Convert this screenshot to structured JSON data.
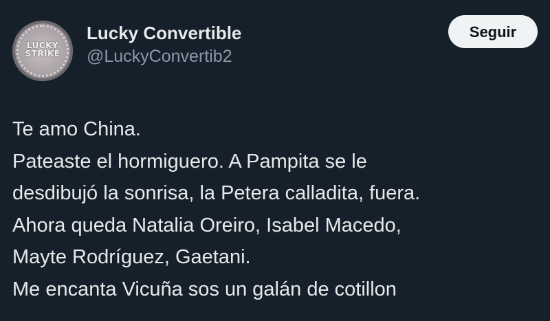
{
  "author": {
    "display_name": "Lucky Convertible",
    "handle": "@LuckyConvertib2",
    "avatar_text": "LUCKY STRIKE"
  },
  "follow_button": {
    "label": "Seguir"
  },
  "tweet": {
    "lines": [
      "Te amo China.",
      "Pateaste el hormiguero. A Pampita se le",
      "desdibujó la sonrisa, la Petera calladita, fuera.",
      "Ahora queda Natalia Oreiro, Isabel Macedo,",
      "Mayte Rodríguez, Gaetani.",
      "Me encanta Vicuña sos un galán de cotillon"
    ]
  },
  "colors": {
    "background": "#15202b",
    "text_primary": "#e7e9ea",
    "text_secondary": "#8b98a5",
    "button_bg": "#eff3f4",
    "button_text": "#0f1419"
  }
}
